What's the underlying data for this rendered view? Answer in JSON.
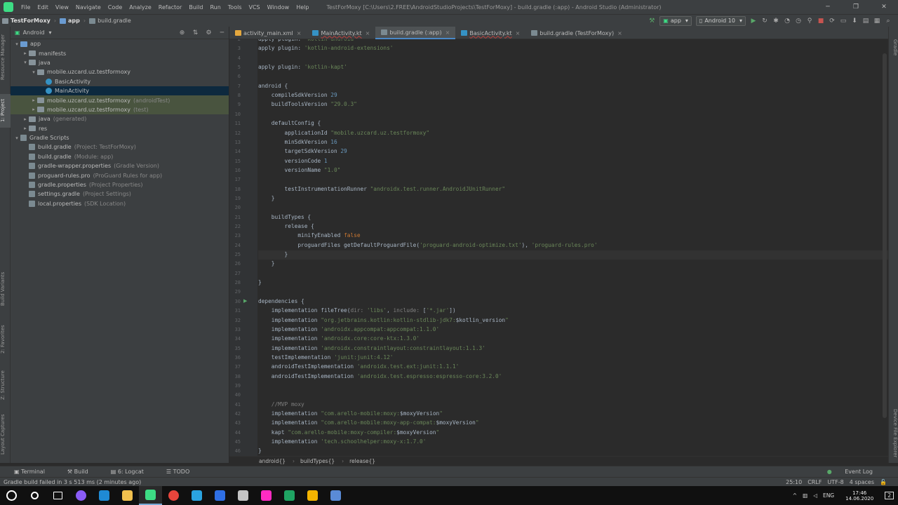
{
  "window": {
    "title": "TestForMoxy [C:\\Users\\2.FREE\\AndroidStudioProjects\\TestForMoxy] - build.gradle (:app) - Android Studio (Administrator)",
    "controls": [
      "─",
      "❐",
      "✕"
    ]
  },
  "menu": [
    "File",
    "Edit",
    "View",
    "Navigate",
    "Code",
    "Analyze",
    "Refactor",
    "Build",
    "Run",
    "Tools",
    "VCS",
    "Window",
    "Help"
  ],
  "navbar": {
    "crumbs": [
      "TestForMoxy",
      "app",
      "build.gradle"
    ],
    "run_config": "app",
    "device": "Android 10"
  },
  "left_stripe": {
    "resource_manager": "Resource Manager",
    "project": "1: Project",
    "build_variants": "Build Variants",
    "favorites": "2: Favorites",
    "structure": "Z: Structure",
    "layout_captures": "Layout Captures"
  },
  "right_stripe": {
    "gradle": "Gradle",
    "device_file_explorer": "Device File Explorer"
  },
  "project": {
    "view_mode": "Android",
    "tree": [
      {
        "label": "app",
        "hint": "",
        "depth": 0,
        "arrow": "▾",
        "icon": "folder-blue",
        "state": ""
      },
      {
        "label": "manifests",
        "hint": "",
        "depth": 1,
        "arrow": "▸",
        "icon": "folder",
        "state": ""
      },
      {
        "label": "java",
        "hint": "",
        "depth": 1,
        "arrow": "▾",
        "icon": "folder",
        "state": ""
      },
      {
        "label": "mobile.uzcard.uz.testformoxy",
        "hint": "",
        "depth": 2,
        "arrow": "▾",
        "icon": "folder",
        "state": ""
      },
      {
        "label": "BasicActivity",
        "hint": "",
        "depth": 3,
        "arrow": "",
        "icon": "class",
        "state": ""
      },
      {
        "label": "MainActivity",
        "hint": "",
        "depth": 3,
        "arrow": "",
        "icon": "class",
        "state": "sel"
      },
      {
        "label": "mobile.uzcard.uz.testformoxy",
        "hint": "(androidTest)",
        "depth": 2,
        "arrow": "▸",
        "icon": "folder",
        "state": "green"
      },
      {
        "label": "mobile.uzcard.uz.testformoxy",
        "hint": "(test)",
        "depth": 2,
        "arrow": "▸",
        "icon": "folder",
        "state": "green"
      },
      {
        "label": "java",
        "hint": "(generated)",
        "depth": 1,
        "arrow": "▸",
        "icon": "folder",
        "state": ""
      },
      {
        "label": "res",
        "hint": "",
        "depth": 1,
        "arrow": "▸",
        "icon": "folder",
        "state": ""
      },
      {
        "label": "Gradle Scripts",
        "hint": "",
        "depth": 0,
        "arrow": "▾",
        "icon": "gradle",
        "state": ""
      },
      {
        "label": "build.gradle",
        "hint": "(Project: TestForMoxy)",
        "depth": 1,
        "arrow": "",
        "icon": "gradle",
        "state": ""
      },
      {
        "label": "build.gradle",
        "hint": "(Module: app)",
        "depth": 1,
        "arrow": "",
        "icon": "gradle",
        "state": ""
      },
      {
        "label": "gradle-wrapper.properties",
        "hint": "(Gradle Version)",
        "depth": 1,
        "arrow": "",
        "icon": "gradle",
        "state": ""
      },
      {
        "label": "proguard-rules.pro",
        "hint": "(ProGuard Rules for app)",
        "depth": 1,
        "arrow": "",
        "icon": "gradle",
        "state": ""
      },
      {
        "label": "gradle.properties",
        "hint": "(Project Properties)",
        "depth": 1,
        "arrow": "",
        "icon": "gradle",
        "state": ""
      },
      {
        "label": "settings.gradle",
        "hint": "(Project Settings)",
        "depth": 1,
        "arrow": "",
        "icon": "gradle",
        "state": ""
      },
      {
        "label": "local.properties",
        "hint": "(SDK Location)",
        "depth": 1,
        "arrow": "",
        "icon": "gradle",
        "state": ""
      }
    ]
  },
  "tabs": [
    {
      "label": "activity_main.xml",
      "active": false,
      "error": false
    },
    {
      "label": "MainActivity.kt",
      "active": false,
      "error": true
    },
    {
      "label": "build.gradle (:app)",
      "active": true,
      "error": false
    },
    {
      "label": "BasicActivity.kt",
      "active": false,
      "error": true
    },
    {
      "label": "build.gradle (TestForMoxy)",
      "active": false,
      "error": false
    }
  ],
  "editor": {
    "current_line": 25,
    "lines": [
      {
        "n": 2,
        "html": "apply plugin: <span class='s'>'kotlin-android'</span>"
      },
      {
        "n": 3,
        "html": "apply plugin: <span class='s'>'kotlin-android-extensions'</span>"
      },
      {
        "n": 4,
        "html": ""
      },
      {
        "n": 5,
        "html": "apply plugin: <span class='s'>'kotlin-kapt'</span>"
      },
      {
        "n": 6,
        "html": ""
      },
      {
        "n": 7,
        "html": "android {"
      },
      {
        "n": 8,
        "html": "    compileSdkVersion <span class='n'>29</span>"
      },
      {
        "n": 9,
        "html": "    buildToolsVersion <span class='s'>\"29.0.3\"</span>"
      },
      {
        "n": 10,
        "html": ""
      },
      {
        "n": 11,
        "html": "    defaultConfig {"
      },
      {
        "n": 12,
        "html": "        applicationId <span class='s'>\"mobile.uzcard.uz.testformoxy\"</span>"
      },
      {
        "n": 13,
        "html": "        minSdkVersion <span class='n'>16</span>"
      },
      {
        "n": 14,
        "html": "        targetSdkVersion <span class='n'>29</span>"
      },
      {
        "n": 15,
        "html": "        versionCode <span class='n'>1</span>"
      },
      {
        "n": 16,
        "html": "        versionName <span class='s'>\"1.0\"</span>"
      },
      {
        "n": 17,
        "html": ""
      },
      {
        "n": 18,
        "html": "        testInstrumentationRunner <span class='s'>\"androidx.test.runner.AndroidJUnitRunner\"</span>"
      },
      {
        "n": 19,
        "html": "    }"
      },
      {
        "n": 20,
        "html": ""
      },
      {
        "n": 21,
        "html": "    buildTypes {"
      },
      {
        "n": 22,
        "html": "        release {"
      },
      {
        "n": 23,
        "html": "            minifyEnabled <span class='k'>false</span>"
      },
      {
        "n": 24,
        "html": "            proguardFiles getDefaultProguardFile(<span class='s'>'proguard-android-optimize.txt'</span>), <span class='s'>'proguard-rules.pro'</span>"
      },
      {
        "n": 25,
        "html": "        }"
      },
      {
        "n": 26,
        "html": "    }"
      },
      {
        "n": 27,
        "html": ""
      },
      {
        "n": 28,
        "html": "}"
      },
      {
        "n": 29,
        "html": ""
      },
      {
        "n": 30,
        "html": "dependencies {"
      },
      {
        "n": 31,
        "html": "    implementation fileTree(<span class='c'>dir:</span> <span class='s'>'libs'</span>, <span class='c'>include:</span> [<span class='s'>'*.jar'</span>])"
      },
      {
        "n": 32,
        "html": "    implementation <span class='s'>\"org.jetbrains.kotlin:kotlin-stdlib-jdk7:</span>$kotlin_version<span class='s'>\"</span>"
      },
      {
        "n": 33,
        "html": "    implementation <span class='s'>'androidx.appcompat:appcompat:1.1.0'</span>"
      },
      {
        "n": 34,
        "html": "    implementation <span class='s'>'androidx.core:core-ktx:1.3.0'</span>"
      },
      {
        "n": 35,
        "html": "    implementation <span class='s'>'androidx.constraintlayout:constraintlayout:1.1.3'</span>"
      },
      {
        "n": 36,
        "html": "    testImplementation <span class='s'>'junit:junit:4.12'</span>"
      },
      {
        "n": 37,
        "html": "    androidTestImplementation <span class='s'>'androidx.test.ext:junit:1.1.1'</span>"
      },
      {
        "n": 38,
        "html": "    androidTestImplementation <span class='s'>'androidx.test.espresso:espresso-core:3.2.0'</span>"
      },
      {
        "n": 39,
        "html": ""
      },
      {
        "n": 40,
        "html": ""
      },
      {
        "n": 41,
        "html": "    <span class='c'>//MVP moxy</span>"
      },
      {
        "n": 42,
        "html": "    implementation <span class='s'>\"com.arello-mobile:moxy:</span>$moxyVersion<span class='s'>\"</span>"
      },
      {
        "n": 43,
        "html": "    implementation <span class='s'>\"com.arello-mobile:moxy-app-compat:</span>$moxyVersion<span class='s'>\"</span>"
      },
      {
        "n": 44,
        "html": "    kapt <span class='s'>\"com.arello-mobile:moxy-compiler:</span>$moxyVersion<span class='s'>\"</span>"
      },
      {
        "n": 45,
        "html": "    implementation <span class='s'>'tech.schoolhelper:moxy-x:1.7.0'</span>"
      },
      {
        "n": 46,
        "html": "}"
      }
    ]
  },
  "editor_breadcrumbs": [
    "android{}",
    "buildTypes{}",
    "release{}"
  ],
  "bottom_tools": [
    "Terminal",
    "Build",
    "6: Logcat",
    "TODO"
  ],
  "event_log": "Event Log",
  "status": {
    "message": "Gradle build failed in 3 s 513 ms (2 minutes ago)",
    "position": "25:10",
    "line_sep": "CRLF",
    "encoding": "UTF-8",
    "indent": "4 spaces"
  },
  "taskbar": {
    "lang": "ENG",
    "time": "17:46",
    "date": "14.06.2020",
    "notifications": "2",
    "apps": [
      {
        "name": "start-icon",
        "color": "#ffffff"
      },
      {
        "name": "search-icon",
        "color": "#ffffff"
      },
      {
        "name": "task-view-icon",
        "color": "#ffffff"
      },
      {
        "name": "app-purple-icon",
        "color": "#8a5cf6"
      },
      {
        "name": "edge-icon",
        "color": "#1f8ad4"
      },
      {
        "name": "explorer-icon",
        "color": "#f2c14e"
      },
      {
        "name": "android-studio-icon",
        "color": "#3ddc84"
      },
      {
        "name": "chrome-icon",
        "color": "#e8453c"
      },
      {
        "name": "telegram-icon",
        "color": "#2aa3e0"
      },
      {
        "name": "app-blue-icon",
        "color": "#2f6fe4"
      },
      {
        "name": "app-gray-icon",
        "color": "#c4c4c4"
      },
      {
        "name": "xd-icon",
        "color": "#ff2bc2"
      },
      {
        "name": "app-green-icon",
        "color": "#1fa463"
      },
      {
        "name": "app-colorful-icon",
        "color": "#f4b400"
      },
      {
        "name": "app-doc-icon",
        "color": "#5a8bd6"
      }
    ]
  }
}
